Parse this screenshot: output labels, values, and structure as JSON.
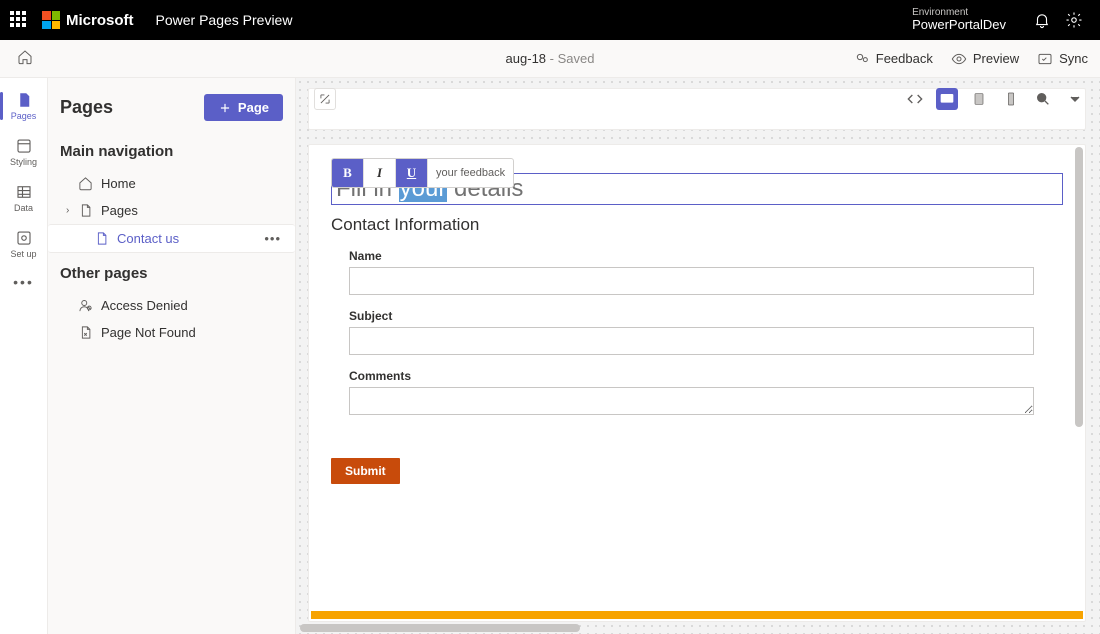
{
  "topbar": {
    "brand": "Microsoft",
    "app_title": "Power Pages Preview",
    "env_label": "Environment",
    "env_name": "PowerPortalDev"
  },
  "cmdbar": {
    "doc_name": "aug-18",
    "doc_status": " - Saved",
    "feedback": "Feedback",
    "preview": "Preview",
    "sync": "Sync"
  },
  "rail": {
    "pages": "Pages",
    "styling": "Styling",
    "data": "Data",
    "setup": "Set up"
  },
  "panel": {
    "title": "Pages",
    "add_page": "Page",
    "section_main": "Main navigation",
    "section_other": "Other pages",
    "home": "Home",
    "pages_node": "Pages",
    "contact": "Contact us",
    "access_denied": "Access Denied",
    "not_found": "Page Not Found"
  },
  "canvas": {
    "fmt_tail": "your feedback",
    "heading_pre": "Fill in ",
    "heading_sel": "your",
    "heading_post": " details",
    "sub_heading": "Contact Information",
    "label_name": "Name",
    "label_subject": "Subject",
    "label_comments": "Comments",
    "submit": "Submit"
  }
}
